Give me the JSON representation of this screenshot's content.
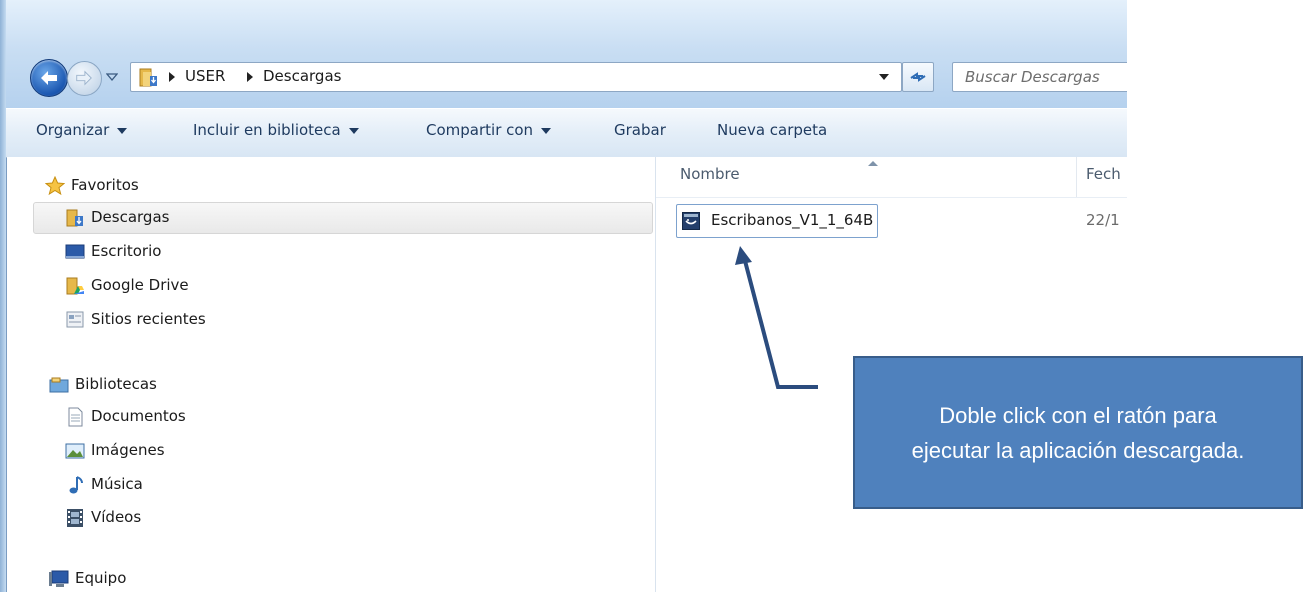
{
  "address": {
    "crumbs": [
      "USER",
      "Descargas"
    ]
  },
  "search": {
    "placeholder": "Buscar Descargas"
  },
  "toolbar": {
    "items": [
      "Organizar",
      "Incluir en biblioteca",
      "Compartir con",
      "Grabar",
      "Nueva carpeta"
    ]
  },
  "navpane": {
    "favorites": {
      "header": "Favoritos",
      "items": [
        "Descargas",
        "Escritorio",
        "Google Drive",
        "Sitios recientes"
      ]
    },
    "libraries": {
      "header": "Bibliotecas",
      "items": [
        "Documentos",
        "Imágenes",
        "Música",
        "Vídeos"
      ]
    },
    "computer": {
      "header": "Equipo"
    }
  },
  "content": {
    "columns": [
      "Nombre",
      "Fech"
    ],
    "files": [
      {
        "name": "Escribanos_V1_1_64B",
        "date": "22/1"
      }
    ]
  },
  "annotation": {
    "text": "Doble click con el ratón para ejecutar la aplicación descargada."
  },
  "colors": {
    "callout_fill": "#4f81bd",
    "callout_border": "#385d8a",
    "arrow": "#385d8a",
    "toolbar_text": "#1e3a5f"
  },
  "icons": {
    "nav_back": "back-arrow-icon",
    "nav_forward": "forward-arrow-icon",
    "folder": "downloads-folder-icon",
    "refresh": "refresh-icon",
    "favorites": "star-icon",
    "desktop": "desktop-icon",
    "google_drive": "google-drive-folder-icon",
    "recent": "recent-places-icon",
    "libraries": "libraries-icon",
    "documents": "document-icon",
    "pictures": "picture-icon",
    "music": "music-note-icon",
    "videos": "film-icon",
    "computer": "computer-icon",
    "application": "application-icon"
  }
}
